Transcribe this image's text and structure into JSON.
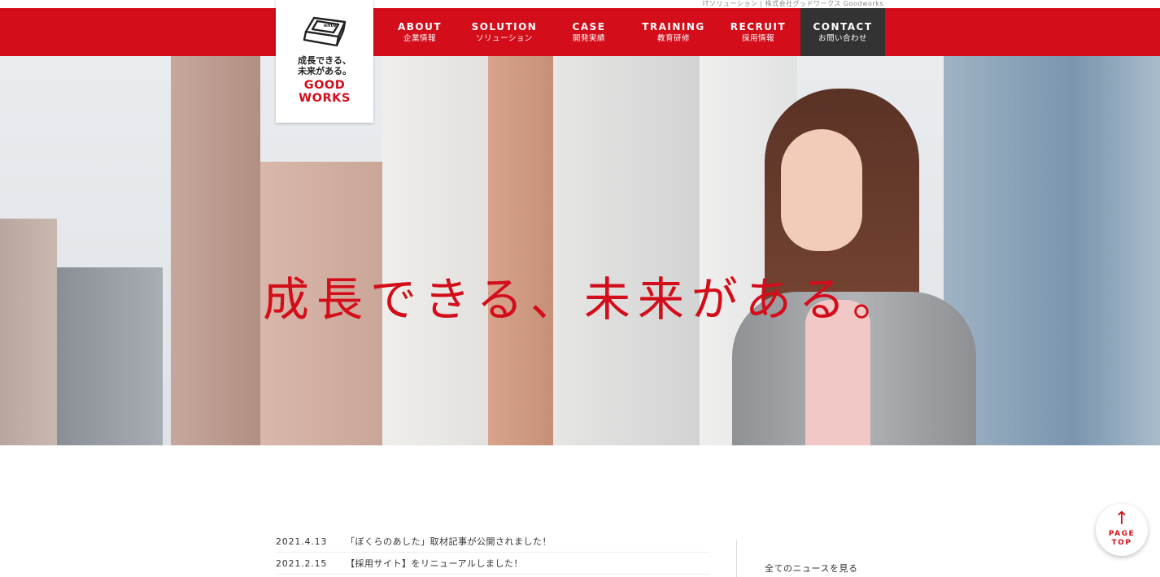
{
  "header": {
    "tagline": "ITソリューション | 株式会社グッドワークス Goodworks",
    "logo": {
      "line1": "成長できる、",
      "line2": "未来がある。",
      "word1": "GOOD",
      "word2": "WORKS"
    },
    "nav": [
      {
        "en": "ABOUT",
        "ja": "企業情報"
      },
      {
        "en": "SOLUTION",
        "ja": "ソリューション"
      },
      {
        "en": "CASE",
        "ja": "開発実績"
      },
      {
        "en": "TRAINING",
        "ja": "教育研修"
      },
      {
        "en": "RECRUIT",
        "ja": "採用情報"
      },
      {
        "en": "CONTACT",
        "ja": "お問い合わせ"
      }
    ]
  },
  "hero": {
    "copy": "成長できる、未来がある。"
  },
  "news": {
    "items": [
      {
        "date": "2021.4.13",
        "title": "「ぼくらのあした」取材記事が公開されました！"
      },
      {
        "date": "2021.2.15",
        "title": "【採用サイト】をリニューアルしました！"
      }
    ],
    "all_link": "全てのニュースを見る"
  },
  "pagetop": {
    "line1": "PAGE",
    "line2": "TOP"
  },
  "colors": {
    "brand_red": "#d30d1a",
    "contact_bg": "#333333"
  }
}
